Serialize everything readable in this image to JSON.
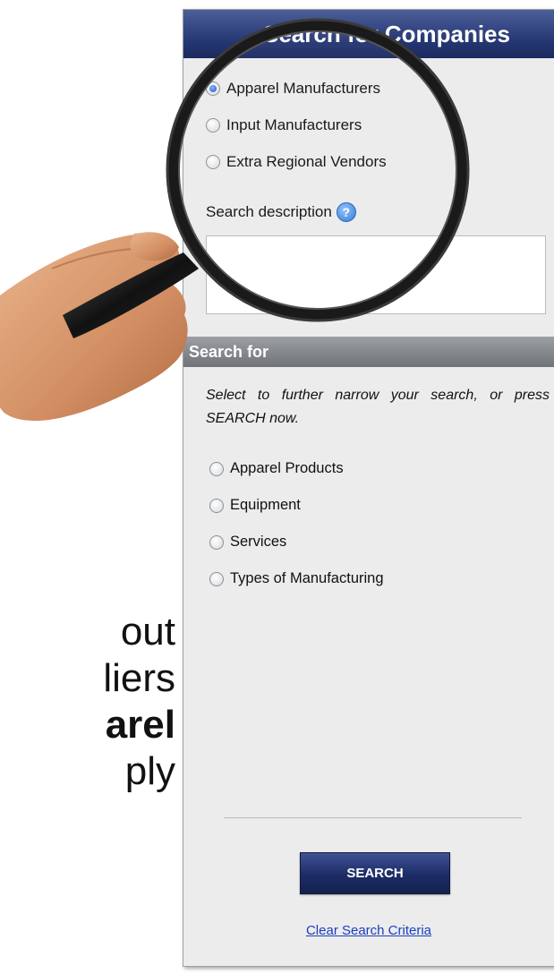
{
  "side_text": {
    "line1": "out",
    "line2": "liers",
    "line3": "arel",
    "line4": "ply"
  },
  "panel": {
    "title": "Search for Companies",
    "company_types": [
      {
        "label": "Apparel Manufacturers",
        "checked": true
      },
      {
        "label": "Input Manufacturers",
        "checked": false
      },
      {
        "label": "Extra Regional Vendors",
        "checked": false
      }
    ],
    "description_label": "Search description",
    "description_value": "",
    "section_title": "Search for",
    "instructions": "Select to further narrow your search, or press SEARCH now.",
    "filters": [
      {
        "label": "Apparel Products",
        "checked": false
      },
      {
        "label": "Equipment",
        "checked": false
      },
      {
        "label": "Services",
        "checked": false
      },
      {
        "label": "Types of Manufacturing",
        "checked": false
      }
    ],
    "search_button": "SEARCH",
    "clear_link": "Clear Search Criteria"
  },
  "colors": {
    "header": "#233471",
    "panel_bg": "#ececec",
    "section_bar": "#7d8185",
    "link": "#1a3fbf"
  },
  "icons": [
    "help-icon",
    "magnifying-glass-icon",
    "hand-icon"
  ]
}
